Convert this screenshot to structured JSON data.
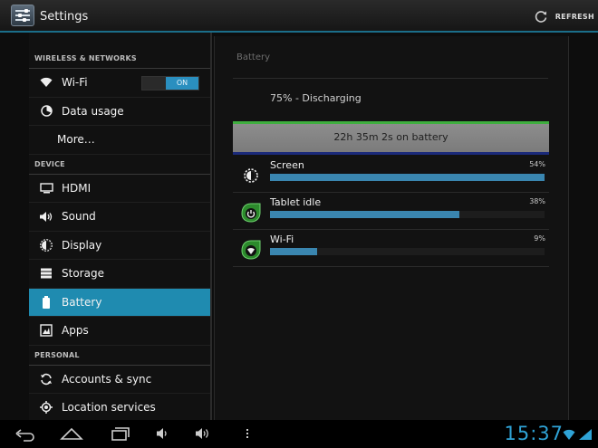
{
  "app": {
    "title": "Settings",
    "refresh_label": "REFRESH"
  },
  "sidebar": {
    "sections": [
      {
        "header": "WIRELESS & NETWORKS"
      },
      {
        "header": "DEVICE"
      },
      {
        "header": "PERSONAL"
      }
    ],
    "wifi": {
      "label": "Wi-Fi",
      "toggle": "ON"
    },
    "data_usage": {
      "label": "Data usage"
    },
    "more": {
      "label": "More…"
    },
    "hdmi": {
      "label": "HDMI"
    },
    "sound": {
      "label": "Sound"
    },
    "display": {
      "label": "Display"
    },
    "storage": {
      "label": "Storage"
    },
    "battery": {
      "label": "Battery"
    },
    "apps": {
      "label": "Apps"
    },
    "accounts": {
      "label": "Accounts & sync"
    },
    "location": {
      "label": "Location services"
    }
  },
  "main": {
    "title": "Battery",
    "status": "75% - Discharging",
    "graph_label": "22h 35m 2s on battery",
    "usage": [
      {
        "name": "Screen",
        "percent_label": "54%",
        "fraction": 1.0,
        "icon": "brightness-icon"
      },
      {
        "name": "Tablet idle",
        "percent_label": "38%",
        "fraction": 0.69,
        "icon": "power-icon"
      },
      {
        "name": "Wi-Fi",
        "percent_label": "9%",
        "fraction": 0.17,
        "icon": "wifi-icon"
      }
    ]
  },
  "statusbar": {
    "clock": "15:37"
  },
  "colors": {
    "accent": "#1f8bb0",
    "bar": "#3a86b0",
    "graph_line": "#3fae3f",
    "clock": "#2fa3d6"
  }
}
